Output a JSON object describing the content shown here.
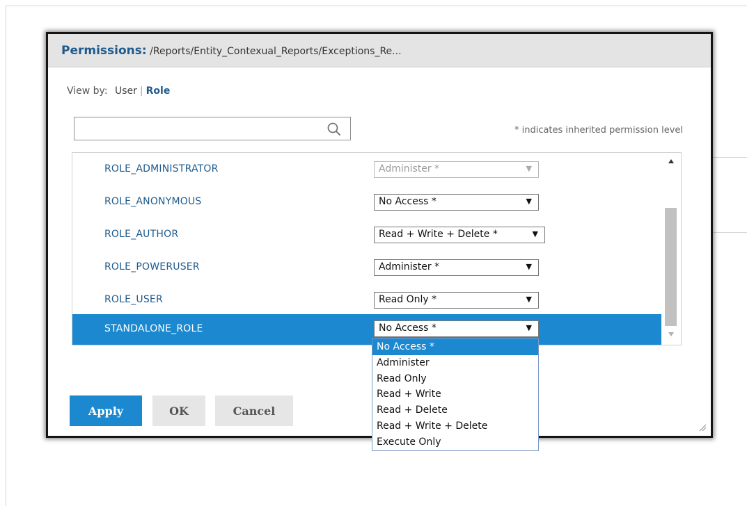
{
  "dialog": {
    "title": "Permissions:",
    "path": "/Reports/Entity_Contexual_Reports/Exceptions_Re..."
  },
  "view_by": {
    "label": "View by:",
    "user": "User",
    "separator": "|",
    "role": "Role",
    "selected": "Role"
  },
  "search": {
    "value": "",
    "icon": "search-icon"
  },
  "inherit_note": "* indicates inherited permission level",
  "roles": [
    {
      "name": "ROLE_ADMINISTRATOR",
      "permission": "Administer *",
      "disabled": true
    },
    {
      "name": "ROLE_ANONYMOUS",
      "permission": "No Access *"
    },
    {
      "name": "ROLE_AUTHOR",
      "permission": "Read + Write + Delete *"
    },
    {
      "name": "ROLE_POWERUSER",
      "permission": "Administer *"
    },
    {
      "name": "ROLE_USER",
      "permission": "Read Only *"
    },
    {
      "name": "STANDALONE_ROLE",
      "permission": "No Access *",
      "selected": true
    }
  ],
  "dropdown": {
    "open_for": "STANDALONE_ROLE",
    "highlighted": "No Access *",
    "options": [
      "No Access *",
      "Administer",
      "Read Only",
      "Read + Write",
      "Read + Delete",
      "Read + Write + Delete",
      "Execute Only"
    ]
  },
  "buttons": {
    "apply": "Apply",
    "ok": "OK",
    "cancel": "Cancel"
  },
  "colors": {
    "accent": "#1c88cf",
    "title": "#1e5a8c"
  }
}
